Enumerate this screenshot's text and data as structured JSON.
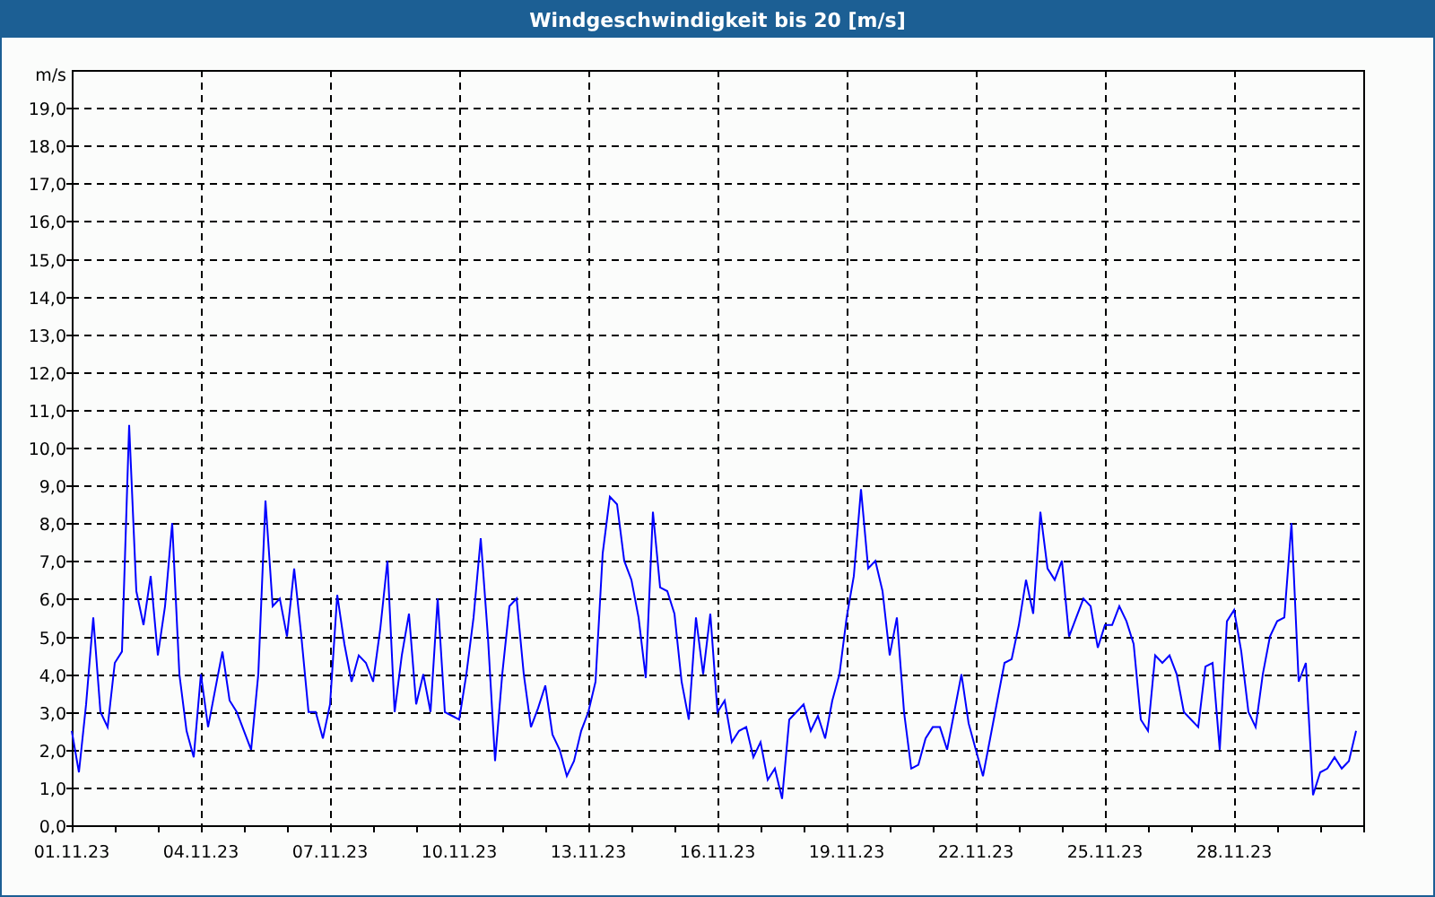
{
  "window": {
    "title": "Windgeschwindigkeit bis 20 [m/s]"
  },
  "chart_data": {
    "type": "line",
    "ylabel": "m/s",
    "categories": [
      "01.11.23",
      null,
      null,
      null,
      null,
      null,
      null,
      null,
      null,
      null,
      null,
      null,
      null,
      null,
      null,
      null,
      null,
      null,
      "04.11.23",
      null,
      null,
      null,
      null,
      null,
      null,
      null,
      null,
      null,
      null,
      null,
      null,
      null,
      null,
      null,
      null,
      null,
      "07.11.23",
      null,
      null,
      null,
      null,
      null,
      null,
      null,
      null,
      null,
      null,
      null,
      null,
      null,
      null,
      null,
      null,
      null,
      "10.11.23",
      null,
      null,
      null,
      null,
      null,
      null,
      null,
      null,
      null,
      null,
      null,
      null,
      null,
      null,
      null,
      null,
      null,
      "13.11.23",
      null,
      null,
      null,
      null,
      null,
      null,
      null,
      null,
      null,
      null,
      null,
      null,
      null,
      null,
      null,
      null,
      null,
      "16.11.23",
      null,
      null,
      null,
      null,
      null,
      null,
      null,
      null,
      null,
      null,
      null,
      null,
      null,
      null,
      null,
      null,
      null,
      "19.11.23",
      null,
      null,
      null,
      null,
      null,
      null,
      null,
      null,
      null,
      null,
      null,
      null,
      null,
      null,
      null,
      null,
      null,
      "22.11.23",
      null,
      null,
      null,
      null,
      null,
      null,
      null,
      null,
      null,
      null,
      null,
      null,
      null,
      null,
      null,
      null,
      null,
      "25.11.23",
      null,
      null,
      null,
      null,
      null,
      null,
      null,
      null,
      null,
      null,
      null,
      null,
      null,
      null,
      null,
      null,
      null,
      "28.11.23",
      null,
      null,
      null,
      null,
      null,
      null,
      null,
      null,
      null,
      null,
      null,
      null,
      null,
      null,
      null,
      null,
      null
    ],
    "series": [
      {
        "color": "#0000ff",
        "values": [
          2.5,
          1.4,
          3.2,
          5.5,
          3.0,
          2.6,
          4.3,
          4.6,
          10.6,
          6.2,
          5.3,
          6.6,
          4.5,
          5.8,
          8.0,
          4.0,
          2.5,
          1.8,
          4.0,
          2.6,
          3.6,
          4.6,
          3.3,
          3.0,
          2.5,
          2.0,
          4.0,
          8.6,
          5.8,
          6.0,
          5.0,
          6.8,
          5.0,
          3.0,
          3.0,
          2.3,
          3.2,
          6.1,
          4.8,
          3.8,
          4.5,
          4.3,
          3.8,
          5.2,
          7.0,
          3.0,
          4.5,
          5.6,
          3.2,
          4.0,
          3.0,
          6.0,
          3.0,
          2.9,
          2.8,
          4.0,
          5.5,
          7.6,
          5.0,
          1.7,
          4.0,
          5.8,
          6.0,
          4.0,
          2.6,
          3.1,
          3.7,
          2.4,
          2.0,
          1.3,
          1.7,
          2.5,
          3.0,
          3.8,
          7.2,
          8.7,
          8.5,
          7.0,
          6.5,
          5.5,
          3.9,
          8.3,
          6.3,
          6.2,
          5.6,
          3.8,
          2.8,
          5.5,
          4.0,
          5.6,
          3.0,
          3.3,
          2.2,
          2.5,
          2.6,
          1.8,
          2.2,
          1.2,
          1.5,
          0.7,
          2.8,
          3.0,
          3.2,
          2.5,
          2.9,
          2.3,
          3.3,
          4.0,
          5.5,
          6.6,
          8.9,
          6.8,
          7.0,
          6.2,
          4.5,
          5.5,
          3.0,
          1.5,
          1.6,
          2.3,
          2.6,
          2.6,
          2.0,
          3.0,
          4.0,
          2.7,
          2.0,
          1.3,
          2.3,
          3.3,
          4.3,
          4.4,
          5.3,
          6.5,
          5.6,
          8.3,
          6.8,
          6.5,
          7.0,
          5.0,
          5.5,
          6.0,
          5.8,
          4.7,
          5.3,
          5.3,
          5.8,
          5.4,
          4.8,
          2.8,
          2.5,
          4.5,
          4.3,
          4.5,
          4.0,
          3.0,
          2.8,
          2.6,
          4.2,
          4.3,
          2.0,
          5.4,
          5.7,
          4.6,
          3.0,
          2.6,
          4.0,
          5.0,
          5.4,
          5.5,
          8.0,
          3.8,
          4.3,
          0.8,
          1.4,
          1.5,
          1.8,
          1.5,
          1.7,
          2.5
        ]
      }
    ],
    "ylim": [
      0,
      20
    ],
    "grid": true,
    "yticks": [
      {
        "value": 0,
        "label": "0,0"
      },
      {
        "value": 1,
        "label": "1,0"
      },
      {
        "value": 2,
        "label": "2,0"
      },
      {
        "value": 3,
        "label": "3,0"
      },
      {
        "value": 4,
        "label": "4,0"
      },
      {
        "value": 5,
        "label": "5,0"
      },
      {
        "value": 6,
        "label": "6,0"
      },
      {
        "value": 7,
        "label": "7,0"
      },
      {
        "value": 8,
        "label": "8,0"
      },
      {
        "value": 9,
        "label": "9,0"
      },
      {
        "value": 10,
        "label": "10,0"
      },
      {
        "value": 11,
        "label": "11,0"
      },
      {
        "value": 12,
        "label": "12,0"
      },
      {
        "value": 13,
        "label": "13,0"
      },
      {
        "value": 14,
        "label": "14,0"
      },
      {
        "value": 15,
        "label": "15,0"
      },
      {
        "value": 16,
        "label": "16,0"
      },
      {
        "value": 17,
        "label": "17,0"
      },
      {
        "value": 18,
        "label": "18,0"
      },
      {
        "value": 19,
        "label": "19,0"
      }
    ]
  }
}
